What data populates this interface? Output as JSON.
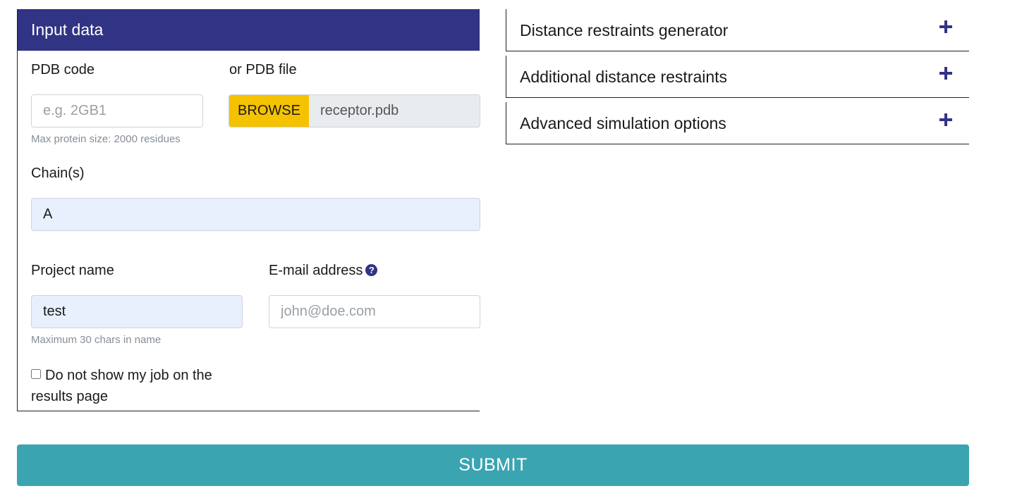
{
  "input_panel": {
    "title": "Input data",
    "pdb_code": {
      "label": "PDB code",
      "placeholder": "e.g. 2GB1",
      "hint": "Max protein size: 2000 residues"
    },
    "pdb_file": {
      "label": "or PDB file",
      "browse_label": "BROWSE",
      "file_name": "receptor.pdb"
    },
    "chains": {
      "label": "Chain(s)",
      "value": "A"
    },
    "project_name": {
      "label": "Project name",
      "value": "test",
      "hint": "Maximum 30 chars in name"
    },
    "email": {
      "label": "E-mail address",
      "placeholder": "john@doe.com",
      "help_icon": "question-circle-icon"
    },
    "hide_job": {
      "label": "Do not show my job on the results page",
      "checked": false
    }
  },
  "accordions": [
    {
      "title": "Distance restraints generator",
      "icon": "plus-icon"
    },
    {
      "title": "Additional distance restraints",
      "icon": "plus-icon"
    },
    {
      "title": "Advanced simulation options",
      "icon": "plus-icon"
    }
  ],
  "submit": {
    "label": "SUBMIT"
  },
  "colors": {
    "header": "#313384",
    "browse": "#f5c200",
    "submit": "#3ba4b1",
    "filled_field": "#e8f0fe"
  }
}
